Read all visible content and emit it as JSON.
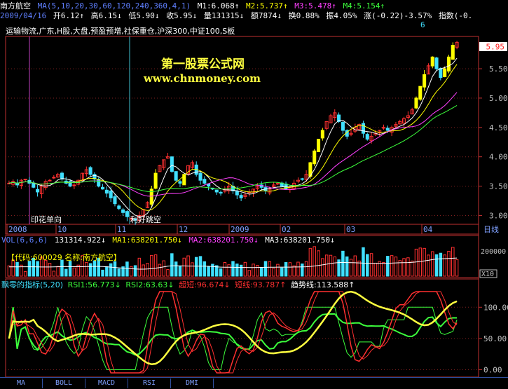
{
  "header": {
    "stock_name": "南方航空",
    "ma_params": "MA(5,10,20,30,60,120,240,360,4,1)",
    "m1": "M1:6.068↑",
    "m2": "M2:5.737↑",
    "m3": "M3:5.478↑",
    "m4": "M4:5.154↑",
    "date": "2009/04/16",
    "open": "开6.12↑",
    "high": "高6.15↓",
    "low": "低5.90↓",
    "close": "收5.95↓",
    "volume": "量131315↓",
    "amount": "额7874↓",
    "turnover": "换0.88%",
    "amplitude": "振4.05%",
    "change": "涨(-0.22)-3.57%",
    "index_label": "指数(-0.",
    "index_tail": "6"
  },
  "tags": "运输物流,广东,H股,大盘,预盈预增,社保重仓,沪深300,中证100,S板",
  "watermark": {
    "title": "第一股票公式网",
    "url": "www.chnmoney.com"
  },
  "annotations": {
    "left": "印花单向",
    "right": "利好跳空"
  },
  "price_axis": {
    "ticks": [
      "5.50",
      "5.00",
      "4.50",
      "4.00",
      "3.50",
      "3.00"
    ],
    "last_price": "5.95"
  },
  "time_axis": {
    "labels": [
      "2008",
      "10",
      "11",
      "12",
      "2009",
      "02",
      "03",
      "04"
    ],
    "unit_label": "日线"
  },
  "volume_panel": {
    "header": "VOL(6,6,6)",
    "vol": "131314.922↓",
    "ma1": "MA1:638201.750↓",
    "ma2": "MA2:638201.750↓",
    "ma3": "MA3:638201.750↓",
    "code_label": "【代码:600029 名称:南方航空】",
    "axis_value": "200000",
    "axis_unit": "X10"
  },
  "indicator_panel": {
    "name": "飘零的指标(5,20)",
    "rsi1": "RSI1:56.773↓",
    "rsi2": "RSI2:63.63↓",
    "overbought": "超短:96.674↓",
    "short": "短线:93.787↑",
    "trend": "趋势线:113.588↑",
    "ticks": [
      "100.00",
      "50.00",
      "0.00"
    ]
  },
  "tabs": [
    "MA",
    "BOLL",
    "MACD",
    "RSI",
    "DMI"
  ],
  "colors": {
    "up": "#ff3030",
    "down": "#40e0ff",
    "limit": "#ffff00",
    "ma5": "#ffffff",
    "ma10": "#ffff00",
    "ma20": "#ff40ff",
    "ma30": "#3cff3c",
    "frame": "#c03030",
    "grid": "#802020"
  },
  "chart_data": {
    "type": "candlestick",
    "ylim": [
      2.85,
      6.05
    ],
    "closes": [
      3.55,
      3.58,
      3.52,
      3.6,
      3.62,
      3.55,
      3.48,
      3.4,
      3.5,
      3.58,
      3.6,
      3.65,
      3.7,
      3.62,
      3.55,
      3.5,
      3.52,
      3.6,
      3.72,
      3.78,
      3.7,
      3.62,
      3.5,
      3.45,
      3.38,
      3.3,
      3.2,
      3.12,
      3.05,
      2.98,
      2.95,
      2.92,
      3.0,
      3.1,
      3.22,
      3.45,
      3.72,
      3.85,
      3.95,
      4.0,
      3.75,
      3.6,
      3.55,
      3.7,
      3.85,
      3.9,
      3.7,
      3.6,
      3.55,
      3.5,
      3.45,
      3.4,
      3.38,
      3.45,
      3.5,
      3.42,
      3.35,
      3.3,
      3.35,
      3.4,
      3.45,
      3.5,
      3.48,
      3.42,
      3.45,
      3.52,
      3.55,
      3.5,
      3.45,
      3.48,
      3.55,
      3.6,
      3.62,
      3.7,
      3.9,
      4.1,
      4.3,
      4.45,
      4.6,
      4.7,
      4.75,
      4.6,
      4.45,
      4.35,
      4.4,
      4.5,
      4.55,
      4.4,
      4.3,
      4.35,
      4.4,
      4.45,
      4.5,
      4.45,
      4.5,
      4.55,
      4.6,
      4.65,
      4.7,
      4.8,
      5.0,
      5.2,
      5.4,
      5.55,
      5.7,
      5.5,
      5.35,
      5.5,
      5.7,
      5.9,
      5.95
    ],
    "vol_ylim": [
      0,
      300000
    ],
    "indicator_ylim": [
      -5,
      125
    ]
  }
}
